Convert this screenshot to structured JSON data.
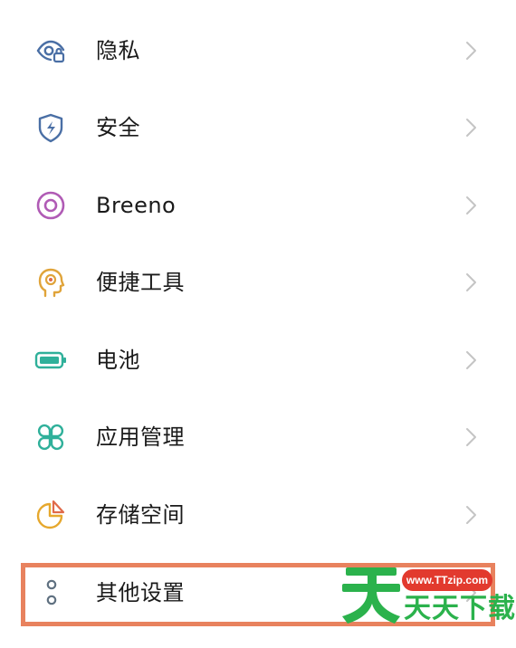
{
  "settings": {
    "items": [
      {
        "label": "隐私",
        "icon": "privacy-eye-lock-icon"
      },
      {
        "label": "安全",
        "icon": "security-shield-icon"
      },
      {
        "label": "Breeno",
        "icon": "breeno-ring-icon"
      },
      {
        "label": "便捷工具",
        "icon": "convenience-tools-head-icon"
      },
      {
        "label": "电池",
        "icon": "battery-icon"
      },
      {
        "label": "应用管理",
        "icon": "app-management-clover-icon"
      },
      {
        "label": "存储空间",
        "icon": "storage-pie-icon"
      },
      {
        "label": "其他设置",
        "icon": "other-settings-dots-icon"
      }
    ],
    "chevron_icon": "chevron-right-icon"
  },
  "watermark": {
    "url": "www.TTzip.com",
    "text": "天天下载",
    "big_glyph": "天"
  },
  "colors": {
    "highlight_border": "#e8825e",
    "privacy_icon": "#4a6fa5",
    "security_icon": "#4a6fa5",
    "breeno_icon": "#b05bb5",
    "tools_icon": "#e0a43a",
    "battery_icon": "#2fb09a",
    "apps_icon": "#2fb09a",
    "storage_icon": "#e6a82e",
    "storage_accent": "#e06a4a",
    "other_icon": "#5f7080",
    "watermark_green": "#2bb24c",
    "watermark_red": "#e23a2e"
  }
}
